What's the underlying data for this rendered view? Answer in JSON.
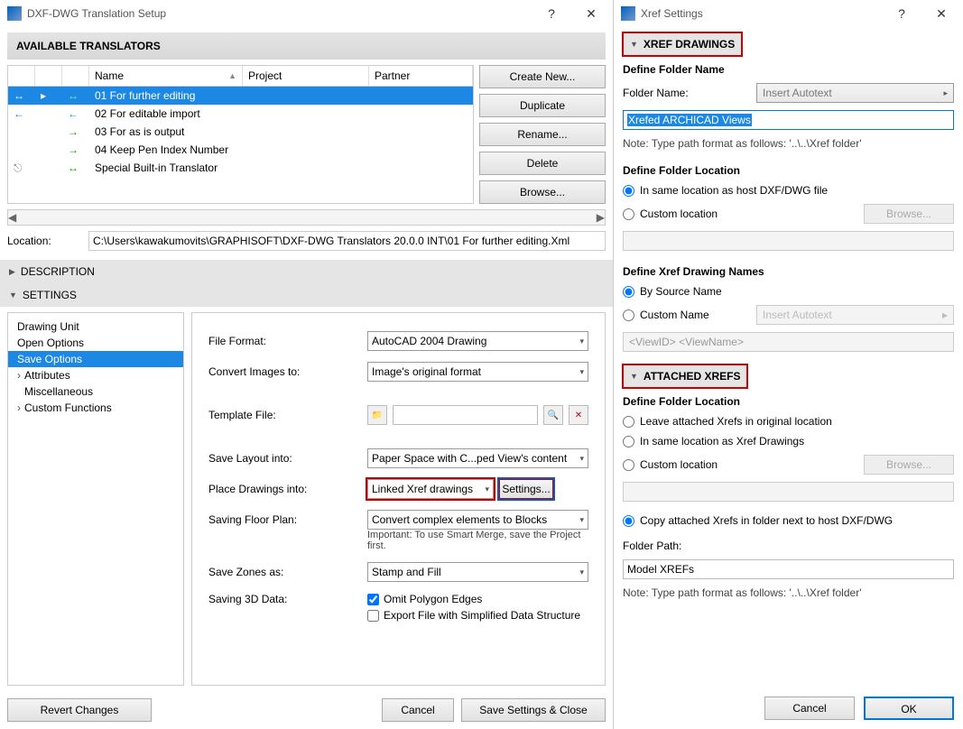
{
  "left_dialog": {
    "title": "DXF-DWG Translation Setup",
    "available_header": "AVAILABLE TRANSLATORS",
    "columns": {
      "name": "Name",
      "project": "Project",
      "partner": "Partner"
    },
    "rows": [
      {
        "name": "01 For further editing",
        "dir1": "↔",
        "dir2": "↔"
      },
      {
        "name": "02 For editable import",
        "dir1": "←",
        "dir2": "←"
      },
      {
        "name": "03 For as is output",
        "dir1": "",
        "dir2": "→"
      },
      {
        "name": "04 Keep Pen Index Number",
        "dir1": "",
        "dir2": "→"
      },
      {
        "name": "Special Built-in Translator",
        "dir1": "",
        "dir2": "↔"
      }
    ],
    "buttons": {
      "create": "Create New...",
      "dup": "Duplicate",
      "rename": "Rename...",
      "del": "Delete",
      "browse": "Browse..."
    },
    "location_label": "Location:",
    "location_value": "C:\\Users\\kawakumovits\\GRAPHISOFT\\DXF-DWG Translators 20.0.0 INT\\01 For further editing.Xml",
    "section_description": "DESCRIPTION",
    "section_settings": "SETTINGS",
    "nav": [
      "Drawing Unit",
      "Open Options",
      "Save Options",
      "Attributes",
      "Miscellaneous",
      "Custom Functions"
    ],
    "form": {
      "file_format": {
        "label": "File Format:",
        "value": "AutoCAD 2004 Drawing"
      },
      "convert_images": {
        "label": "Convert Images to:",
        "value": "Image's original format"
      },
      "template_file": {
        "label": "Template File:"
      },
      "save_layout": {
        "label": "Save Layout into:",
        "value": "Paper Space with C...ped View's content"
      },
      "place_drawings": {
        "label": "Place Drawings into:",
        "value": "Linked Xref drawings",
        "settings_btn": "Settings..."
      },
      "saving_floor": {
        "label": "Saving Floor Plan:",
        "value": "Convert complex elements to Blocks",
        "note": "Important: To use Smart Merge, save the Project first."
      },
      "save_zones": {
        "label": "Save Zones as:",
        "value": "Stamp and Fill"
      },
      "saving_3d": {
        "label": "Saving 3D Data:",
        "omit": "Omit Polygon Edges",
        "simplified": "Export File with Simplified Data Structure"
      }
    },
    "footer": {
      "revert": "Revert Changes",
      "cancel": "Cancel",
      "save": "Save Settings & Close"
    }
  },
  "right_dialog": {
    "title": "Xref Settings",
    "xref_drawings": "XREF DRAWINGS",
    "define_folder_name": "Define Folder Name",
    "folder_name_label": "Folder Name:",
    "insert_autotext": "Insert Autotext",
    "folder_name_value": "Xrefed ARCHICAD Views",
    "path_note": "Note: Type path format as follows:   '..\\..\\Xref folder'",
    "define_folder_location": "Define Folder Location",
    "loc_same_host": "In same location as host DXF/DWG file",
    "loc_custom": "Custom location",
    "browse": "Browse...",
    "define_xref_names": "Define Xref Drawing Names",
    "by_source": "By Source Name",
    "custom_name": "Custom Name",
    "viewid_viewname": "<ViewID> <ViewName>",
    "attached_xrefs": "ATTACHED XREFS",
    "define_folder_location2": "Define Folder Location",
    "leave_original": "Leave attached Xrefs in original location",
    "same_as_xref": "In same location as Xref Drawings",
    "copy_next_host": "Copy attached Xrefs in folder next to host DXF/DWG",
    "folder_path_label": "Folder Path:",
    "folder_path_value": "Model XREFs",
    "cancel": "Cancel",
    "ok": "OK"
  }
}
